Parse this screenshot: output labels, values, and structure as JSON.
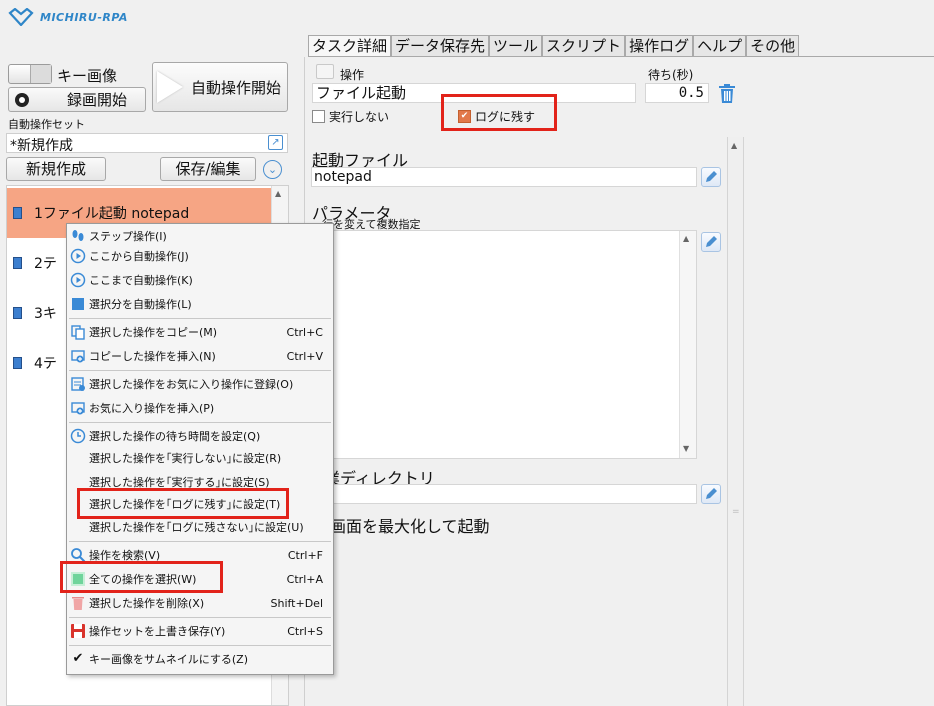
{
  "app": {
    "logo_text": "MICHIRU-RPA"
  },
  "left": {
    "key_image_label": "キー画像",
    "record_button": "録画開始",
    "auto_start_button": "自動操作開始",
    "set_label": "自動操作セット",
    "set_value": "*新規作成",
    "new_button": "新規作成",
    "save_button": "保存/編集",
    "steps": [
      {
        "label": "1ファイル起動 notepad",
        "selected": true
      },
      {
        "label": "2テ"
      },
      {
        "label": "3キ"
      },
      {
        "label": "4テ"
      }
    ]
  },
  "tabs": [
    "タスク詳細",
    "データ保存先",
    "ツール",
    "スクリプト",
    "操作ログ",
    "ヘルプ",
    "その他"
  ],
  "detail": {
    "op_label": "操作",
    "wait_label": "待ち(秒)",
    "op_value": "ファイル起動",
    "wait_value": "0.5",
    "no_exec_label": "実行しない",
    "log_label": "ログに残す",
    "file_label": "起動ファイル",
    "file_value": "notepad",
    "param_label": "パラメータ",
    "param_sub": "行を変えて複数指定",
    "workdir_label": "業ディレクトリ",
    "maximize_label": "画面を最大化して起動"
  },
  "menu": {
    "items": [
      {
        "label": "ステップ操作(I)",
        "shortcut": "",
        "icon": "step-icon"
      },
      {
        "label": "ここから自動操作(J)",
        "shortcut": "",
        "icon": "play-circle-icon"
      },
      {
        "label": "ここまで自動操作(K)",
        "shortcut": "",
        "icon": "play-circle-icon"
      },
      {
        "label": "選択分を自動操作(L)",
        "shortcut": "",
        "icon": "square-icon"
      },
      {
        "label": "選択した操作をコピー(M)",
        "shortcut": "Ctrl+C",
        "icon": "copy-icon"
      },
      {
        "label": "コピーした操作を挿入(N)",
        "shortcut": "Ctrl+V",
        "icon": "insert-icon"
      },
      {
        "label": "選択した操作をお気に入り操作に登録(O)",
        "shortcut": "",
        "icon": "favorite-register-icon"
      },
      {
        "label": "お気に入り操作を挿入(P)",
        "shortcut": "",
        "icon": "insert-icon"
      },
      {
        "label": "選択した操作の待ち時間を設定(Q)",
        "shortcut": "",
        "icon": "clock-icon"
      },
      {
        "label": "選択した操作を｢実行しない｣に設定(R)",
        "shortcut": "",
        "icon": ""
      },
      {
        "label": "選択した操作を｢実行する｣に設定(S)",
        "shortcut": "",
        "icon": ""
      },
      {
        "label": "選択した操作を｢ログに残す｣に設定(T)",
        "shortcut": "",
        "icon": ""
      },
      {
        "label": "選択した操作を｢ログに残さない｣に設定(U)",
        "shortcut": "",
        "icon": ""
      },
      {
        "label": "操作を検索(V)",
        "shortcut": "Ctrl+F",
        "icon": "search-icon"
      },
      {
        "label": "全ての操作を選択(W)",
        "shortcut": "Ctrl+A",
        "icon": "select-all-icon"
      },
      {
        "label": "選択した操作を削除(X)",
        "shortcut": "Shift+Del",
        "icon": "trash-icon"
      },
      {
        "label": "操作セットを上書き保存(Y)",
        "shortcut": "Ctrl+S",
        "icon": "save-icon"
      },
      {
        "label": "キー画像をサムネイルにする(Z)",
        "shortcut": "",
        "icon": "check-icon"
      }
    ]
  },
  "colors": {
    "accent": "#2f86c8",
    "selected_row": "#f6a584",
    "highlight": "#e2231a",
    "checkbox_on": "#e2784a"
  }
}
